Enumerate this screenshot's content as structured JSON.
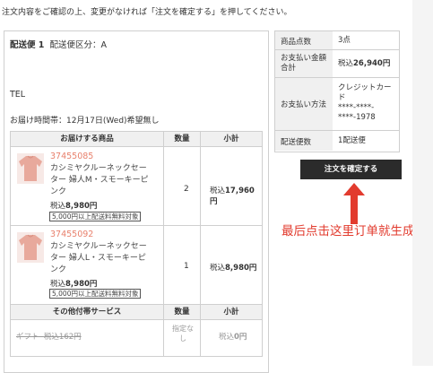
{
  "instruction": "注文内容をご確認の上、変更がなければ「注文を確定する」を押してください。",
  "shipment": {
    "title": "配送便 1",
    "type_label": "配送便区分：A",
    "tel_label": "TEL",
    "delivery_time": "お届け時間帯：12月17日(Wed)希望無し"
  },
  "items_table": {
    "headers": [
      "お届けする商品",
      "数量",
      "小計"
    ],
    "rows": [
      {
        "code": "37455085",
        "name": "カシミヤクルーネックセーター 婦人M・スモーキーピンク",
        "price_prefix": "税込",
        "price": "8,980円",
        "badge": "5,000円以上配送料無料対象",
        "qty": "2",
        "subtotal_prefix": "税込",
        "subtotal": "17,960円"
      },
      {
        "code": "37455092",
        "name": "カシミヤクルーネックセーター 婦人L・スモーキーピンク",
        "price_prefix": "税込",
        "price": "8,980円",
        "badge": "5,000円以上配送料無料対象",
        "qty": "1",
        "subtotal_prefix": "税込",
        "subtotal": "8,980円"
      }
    ]
  },
  "service_table": {
    "headers": [
      "その他付帯サービス",
      "数量",
      "小計"
    ],
    "row": {
      "name": "ギフト",
      "price": "税込162円",
      "qty": "指定なし",
      "subtotal_prefix": "税込",
      "subtotal": "0円"
    }
  },
  "summary": [
    {
      "label": "商品点数",
      "value": "3点"
    },
    {
      "label": "お支払い金額合計",
      "value_prefix": "税込",
      "value": "26,940円"
    },
    {
      "label": "お支払い方法",
      "value": "クレジットカード\n****-****-\n****-1978"
    },
    {
      "label": "配送便数",
      "value": "1配送便"
    }
  ],
  "confirm_button": "注文を確定する",
  "annotation": "最后点击这里订单就生成了",
  "colors": {
    "accent": "#e23b2e",
    "button": "#2b2b2b",
    "product_code": "#e8806c"
  },
  "icons": [
    "sweater-thumbnail",
    "red-arrow-up-icon"
  ]
}
